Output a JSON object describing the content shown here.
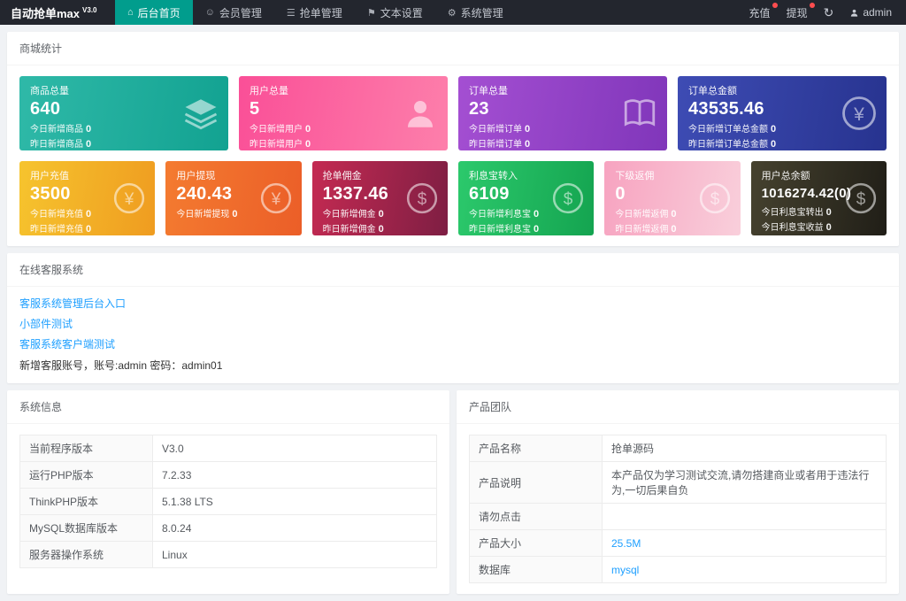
{
  "navbar": {
    "logo": "自动抢单max",
    "version": "V3.0",
    "menu": [
      {
        "label": "后台首页",
        "glyph": "⌂",
        "active": true
      },
      {
        "label": "会员管理",
        "glyph": "☺",
        "active": false
      },
      {
        "label": "抢单管理",
        "glyph": "☰",
        "active": false
      },
      {
        "label": "文本设置",
        "glyph": "⚑",
        "active": false
      },
      {
        "label": "系统管理",
        "glyph": "⚙",
        "active": false
      }
    ],
    "right": {
      "recharge": "充值",
      "withdraw": "提现",
      "refresh_icon": "↻",
      "user": "admin"
    }
  },
  "stats": {
    "title": "商城统计",
    "row1": [
      {
        "title": "商品总量",
        "value": "640",
        "sub1": "今日新增商品",
        "sub1v": "0",
        "sub2": "昨日新增商品",
        "sub2v": "0",
        "colors": [
          "#2fb9a8",
          "#12a291"
        ],
        "icon": "layers-icon"
      },
      {
        "title": "用户总量",
        "value": "5",
        "sub1": "今日新增用户",
        "sub1v": "0",
        "sub2": "昨日新增用户",
        "sub2v": "0",
        "colors": [
          "#fa4f97",
          "#fd7fab"
        ],
        "icon": "user-icon"
      },
      {
        "title": "订单总量",
        "value": "23",
        "sub1": "今日新增订单",
        "sub1v": "0",
        "sub2": "昨日新增订单",
        "sub2v": "0",
        "colors": [
          "#a44fd2",
          "#8036ba"
        ],
        "icon": "book-icon"
      },
      {
        "title": "订单总金额",
        "value": "43535.46",
        "sub1": "今日新增订单总金额",
        "sub1v": "0",
        "sub2": "昨日新增订单总金额",
        "sub2v": "0",
        "colors": [
          "#3e4cb4",
          "#27338f"
        ],
        "icon": "yen-circle-icon"
      }
    ],
    "row2": [
      {
        "title": "用户充值",
        "value": "3500",
        "sub1": "今日新增充值",
        "sub1v": "0",
        "sub2": "昨日新增充值",
        "sub2v": "0",
        "colors": [
          "#f6c42e",
          "#ef9c20"
        ],
        "icon": "yen-circle-icon"
      },
      {
        "title": "用户提现",
        "value": "240.43",
        "sub1": "今日新增提现",
        "sub1v": "0",
        "colors": [
          "#f47b30",
          "#eb5e28"
        ],
        "icon": "yen-circle-icon"
      },
      {
        "title": "抢单佣金",
        "value": "1337.46",
        "sub1": "今日新增佣金",
        "sub1v": "0",
        "sub2": "昨日新增佣金",
        "sub2v": "0",
        "colors": [
          "#c42a52",
          "#7e1e43"
        ],
        "icon": "dollar-circle-icon"
      },
      {
        "title": "利息宝转入",
        "value": "6109",
        "sub1": "今日新增利息宝",
        "sub1v": "0",
        "sub2": "昨日新增利息宝",
        "sub2v": "0",
        "colors": [
          "#2cc96c",
          "#14a450"
        ],
        "icon": "dollar-circle-icon"
      },
      {
        "title": "下级返佣",
        "value": "0",
        "sub1": "今日新增返佣",
        "sub1v": "0",
        "sub2": "昨日新增返佣",
        "sub2v": "0",
        "colors": [
          "#f7a3c0",
          "#f9cfdb"
        ],
        "icon": "dollar-circle-icon"
      },
      {
        "title": "用户总余额",
        "value": "1016274.42(0)",
        "sub1": "今日利息宝转出",
        "sub1v": "0",
        "sub2": "今日利息宝收益",
        "sub2v": "0",
        "colors": [
          "#46422f",
          "#201e17"
        ],
        "icon": "dollar-circle-icon"
      }
    ]
  },
  "service": {
    "title": "在线客服系统",
    "links": [
      "客服系统管理后台入口",
      "小部件测试",
      "客服系统客户端测试"
    ],
    "note": "新增客服账号，账号:admin 密码：admin01"
  },
  "sysinfo": {
    "title": "系统信息",
    "rows": [
      {
        "label": "当前程序版本",
        "value": "V3.0"
      },
      {
        "label": "运行PHP版本",
        "value": "7.2.33"
      },
      {
        "label": "ThinkPHP版本",
        "value": "5.1.38 LTS"
      },
      {
        "label": "MySQL数据库版本",
        "value": "8.0.24"
      },
      {
        "label": "服务器操作系统",
        "value": "Linux"
      }
    ]
  },
  "product": {
    "title": "产品团队",
    "rows": [
      {
        "label": "产品名称",
        "value": "抢单源码"
      },
      {
        "label": "产品说明",
        "value": "本产品仅为学习测试交流,请勿搭建商业或者用于违法行为,一切后果自负"
      },
      {
        "label": "请勿点击",
        "value": ""
      },
      {
        "label": "产品大小",
        "value": "25.5M",
        "link": true
      },
      {
        "label": "数据库",
        "value": "mysql",
        "link": true
      }
    ]
  }
}
